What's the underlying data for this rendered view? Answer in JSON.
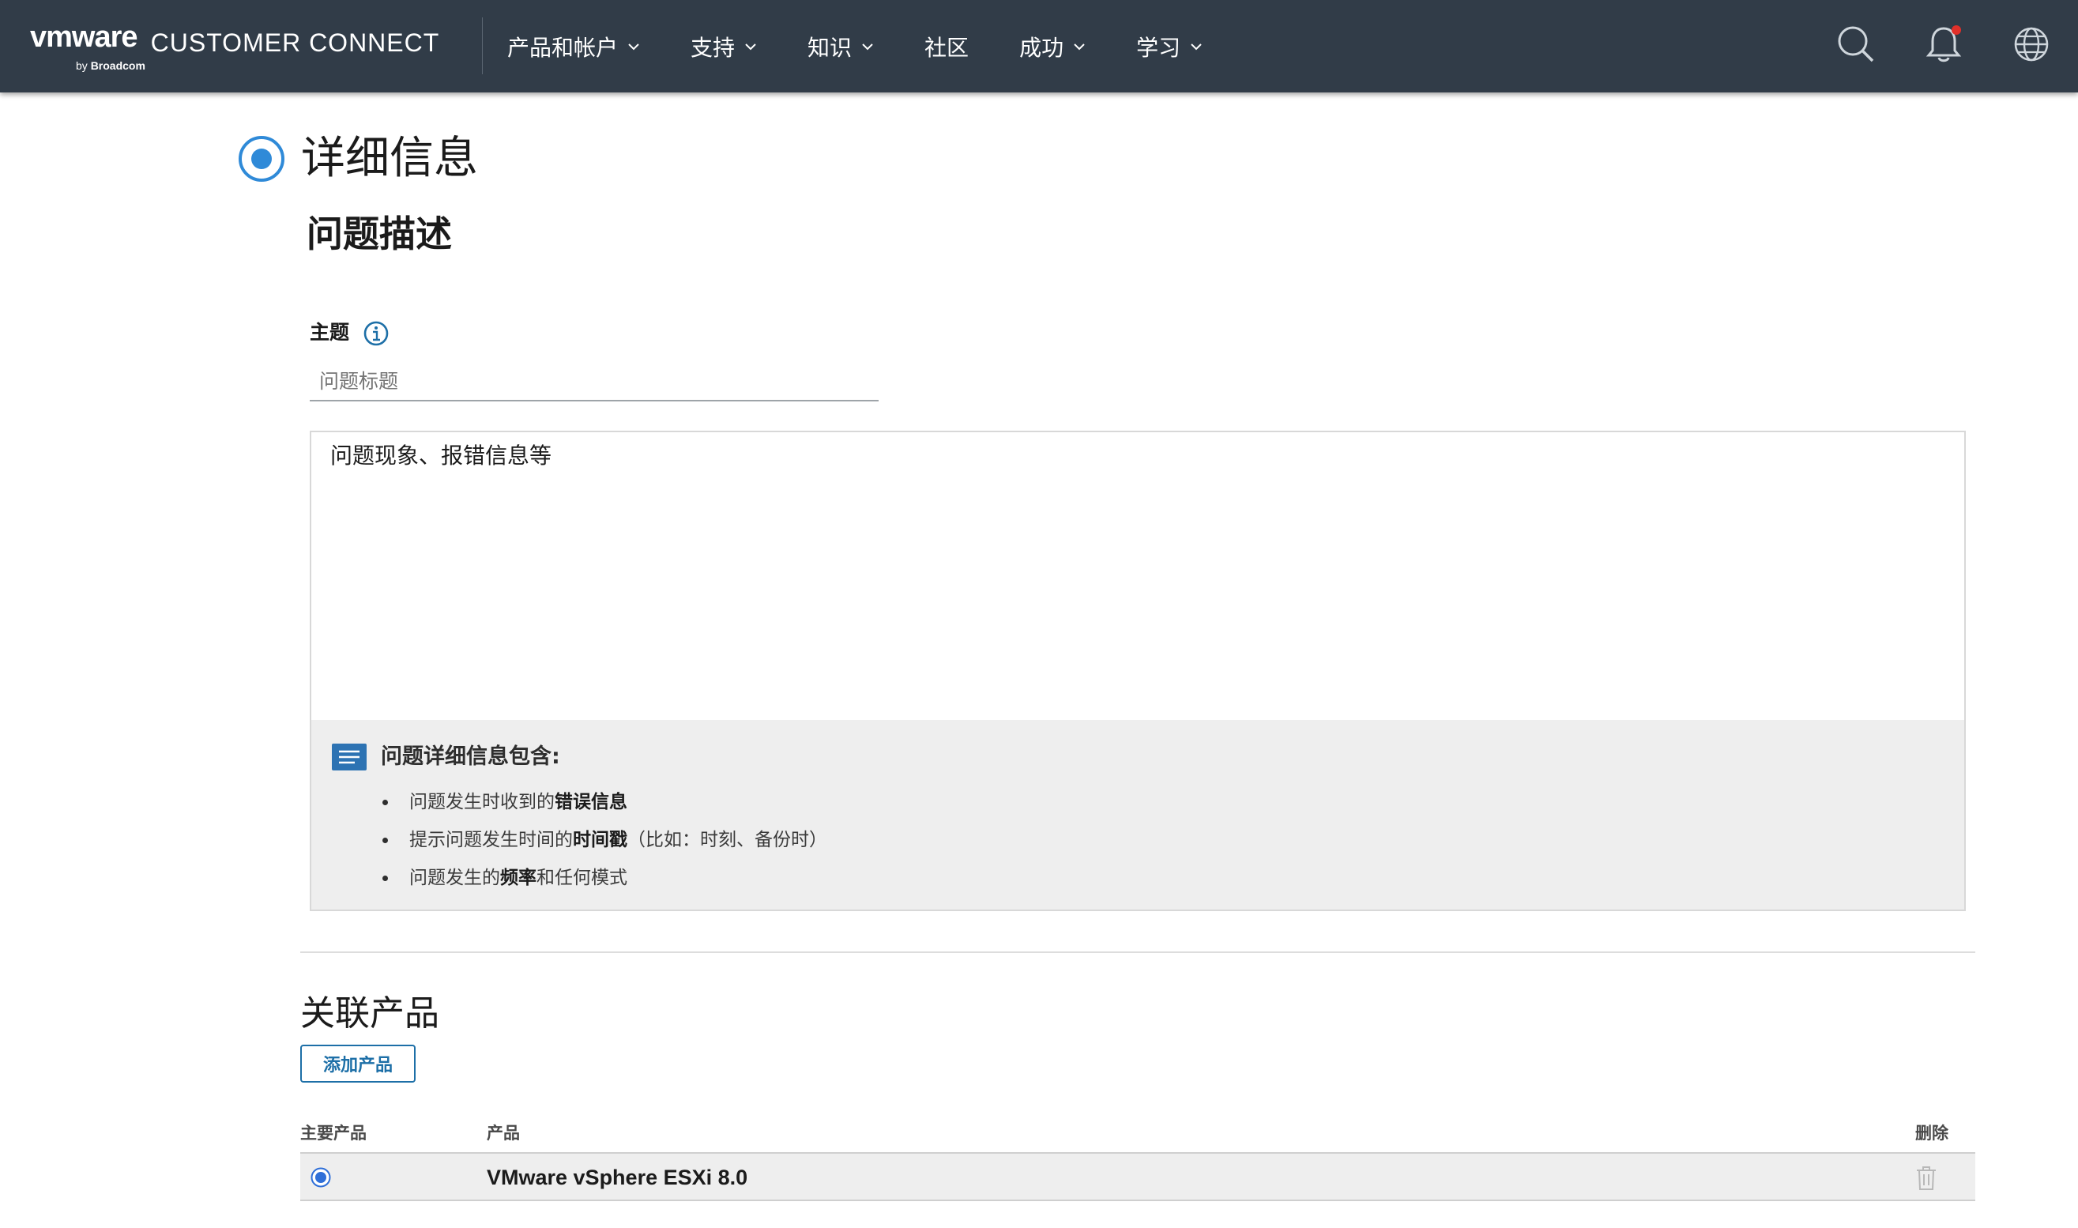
{
  "header": {
    "brand": {
      "logo_text": "vmware",
      "product": "CUSTOMER CONNECT",
      "by": "by",
      "by_company": "Broadcom"
    },
    "nav": [
      {
        "label": "产品和帐户",
        "has_dropdown": true
      },
      {
        "label": "支持",
        "has_dropdown": true
      },
      {
        "label": "知识",
        "has_dropdown": true
      },
      {
        "label": "社区",
        "has_dropdown": false
      },
      {
        "label": "成功",
        "has_dropdown": true
      },
      {
        "label": "学习",
        "has_dropdown": true
      }
    ],
    "icons": [
      "search-icon",
      "bell-icon",
      "globe-icon"
    ],
    "notification_dot_color": "#e0302a"
  },
  "step": {
    "title": "详细信息"
  },
  "problem": {
    "section_title": "问题描述",
    "subject_label": "主题",
    "subject_placeholder": "问题标题",
    "description_placeholder": "问题现象、报错信息等",
    "tips": {
      "title": "问题详细信息包含:",
      "items": [
        {
          "before": "问题发生时收到的",
          "bold": "错误信息",
          "after": ""
        },
        {
          "before": "提示问题发生时间的",
          "bold": "时间戳",
          "after": "（比如：时刻、备份时）"
        },
        {
          "before": "问题发生的",
          "bold": "频率",
          "after": "和任何模式"
        }
      ]
    }
  },
  "related": {
    "title": "关联产品",
    "add_button": "添加产品",
    "columns": {
      "primary": "主要产品",
      "product": "产品",
      "delete": "删除"
    },
    "rows": [
      {
        "primary_selected": true,
        "product": "VMware vSphere ESXi 8.0"
      }
    ]
  },
  "colors": {
    "header_bg": "#313c48",
    "accent": "#1d6fa7",
    "radio": "#2f8ad8"
  }
}
